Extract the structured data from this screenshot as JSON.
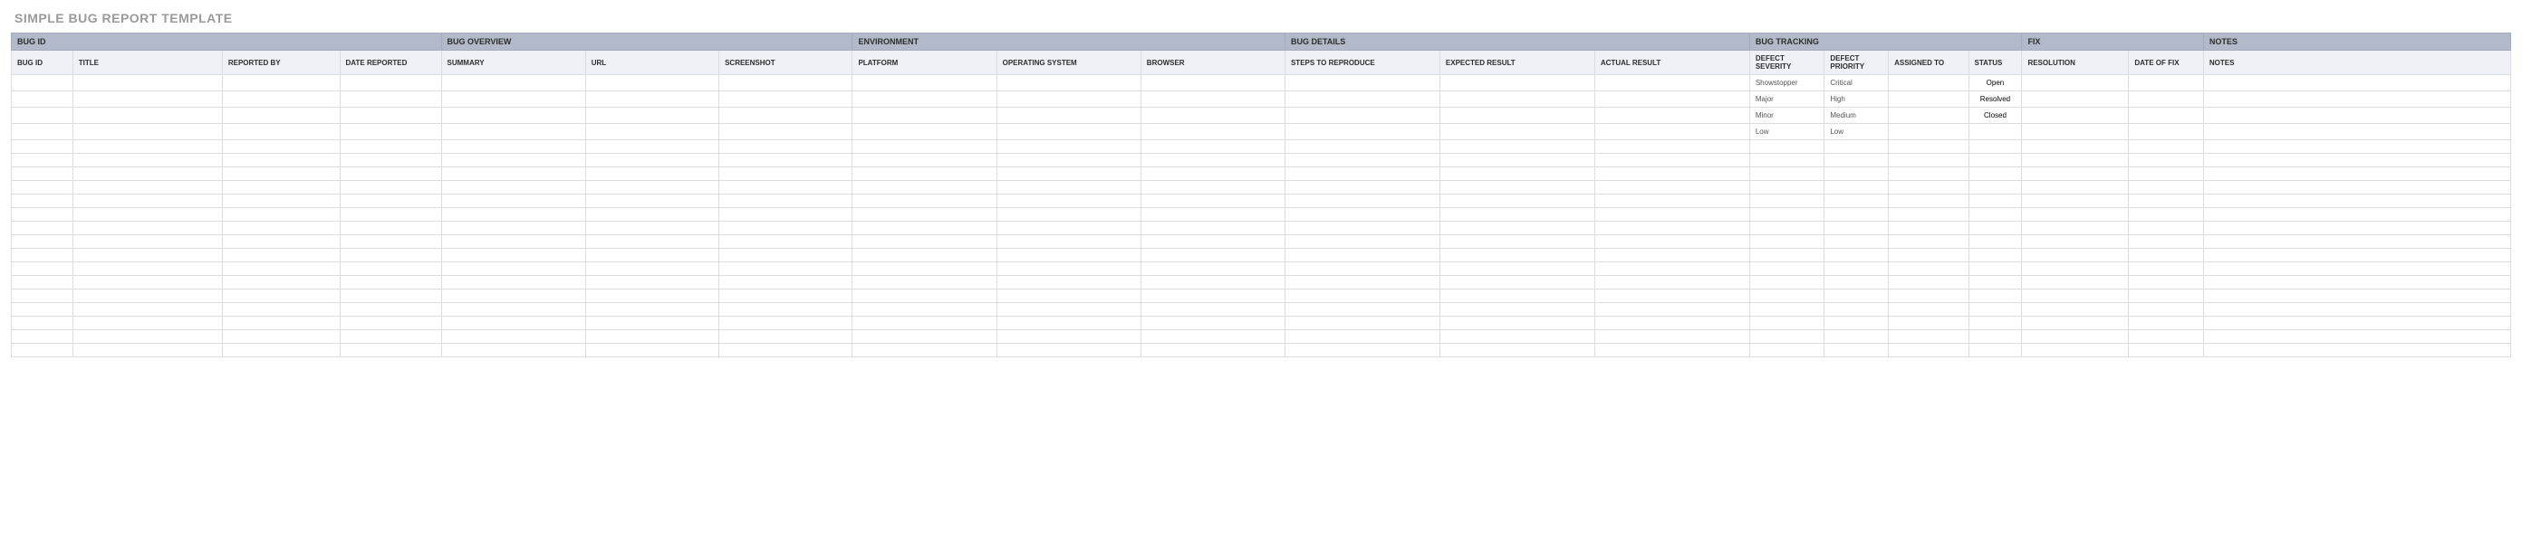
{
  "title": "SIMPLE BUG REPORT TEMPLATE",
  "groups": {
    "bug_id": "BUG ID",
    "bug_overview": "BUG OVERVIEW",
    "environment": "ENVIRONMENT",
    "bug_details": "BUG DETAILS",
    "bug_tracking": "BUG TRACKING",
    "fix": "FIX",
    "notes": "NOTES"
  },
  "columns": {
    "bug_id": "BUG ID",
    "title": "TITLE",
    "reported_by": "REPORTED BY",
    "date_reported": "DATE REPORTED",
    "summary": "SUMMARY",
    "url": "URL",
    "screenshot": "SCREENSHOT",
    "platform": "PLATFORM",
    "operating_system": "OPERATING SYSTEM",
    "browser": "BROWSER",
    "steps_to_reproduce": "STEPS TO REPRODUCE",
    "expected_result": "EXPECTED RESULT",
    "actual_result": "ACTUAL RESULT",
    "defect_severity": "DEFECT SEVERITY",
    "defect_priority": "DEFECT PRIORITY",
    "assigned_to": "ASSIGNED TO",
    "status": "STATUS",
    "resolution": "RESOLUTION",
    "date_of_fix": "DATE OF FIX",
    "notes": "NOTES"
  },
  "rows": [
    {
      "severity": "Showstopper",
      "priority": "Critical",
      "status": "Open",
      "status_class": "status-open"
    },
    {
      "severity": "Major",
      "priority": "High",
      "status": "Resolved",
      "status_class": "status-resolved"
    },
    {
      "severity": "Minor",
      "priority": "Medium",
      "status": "Closed",
      "status_class": "status-closed"
    },
    {
      "severity": "Low",
      "priority": "Low",
      "status": "",
      "status_class": ""
    },
    {},
    {},
    {},
    {},
    {},
    {},
    {},
    {},
    {},
    {},
    {},
    {},
    {},
    {},
    {},
    {}
  ]
}
